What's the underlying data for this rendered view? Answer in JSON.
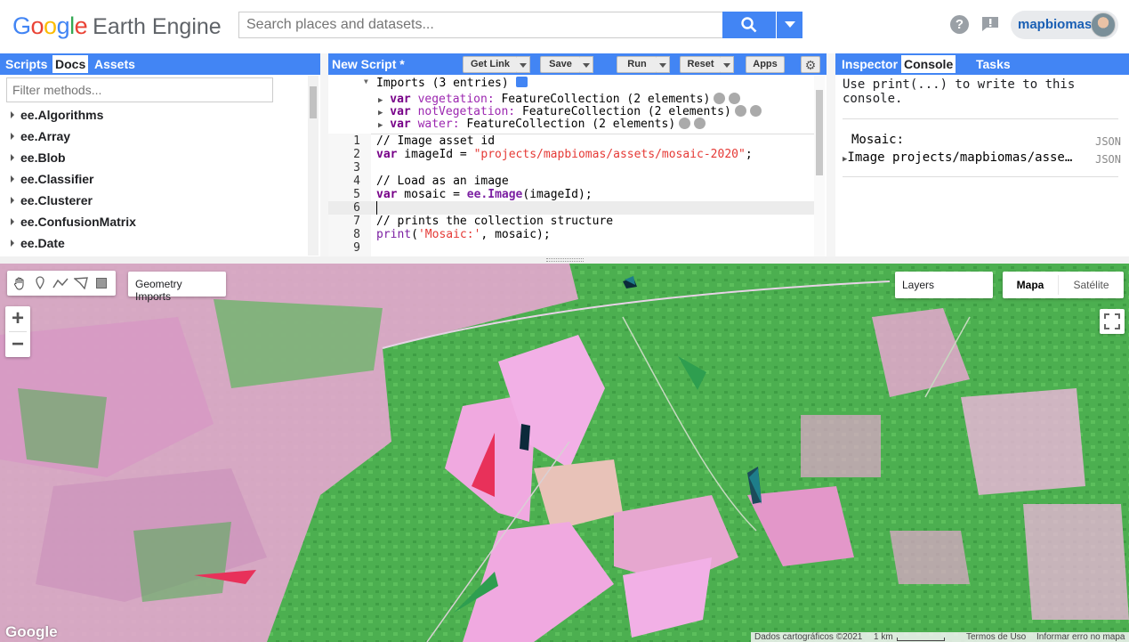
{
  "header": {
    "logo_google": "Google",
    "logo_product": "Earth Engine",
    "search_placeholder": "Search places and datasets...",
    "username": "mapbiomas"
  },
  "left_panel": {
    "tabs": [
      "Scripts",
      "Docs",
      "Assets"
    ],
    "active_tab": "Docs",
    "filter_placeholder": "Filter methods...",
    "doc_items": [
      "ee.Algorithms",
      "ee.Array",
      "ee.Blob",
      "ee.Classifier",
      "ee.Clusterer",
      "ee.ConfusionMatrix",
      "ee.Date"
    ]
  },
  "editor": {
    "title": "New Script *",
    "buttons": {
      "get_link": "Get Link",
      "save": "Save",
      "run": "Run",
      "reset": "Reset",
      "apps": "Apps"
    },
    "imports_header": "Imports (3 entries)",
    "imports": [
      {
        "kw": "var",
        "name": "vegetation:",
        "type": "FeatureCollection (2 elements)"
      },
      {
        "kw": "var",
        "name": "notVegetation:",
        "type": "FeatureCollection (2 elements)"
      },
      {
        "kw": "var",
        "name": "water:",
        "type": "FeatureCollection (2 elements)"
      }
    ],
    "line_numbers": [
      "1",
      "2",
      "3",
      "4",
      "5",
      "6",
      "7",
      "8",
      "9"
    ],
    "code": {
      "l1": "// Image asset id",
      "l2_kw": "var",
      "l2_rest": " imageId = ",
      "l2_str": "\"projects/mapbiomas/assets/mosaic-2020\"",
      "l2_end": ";",
      "l4": "// Load as an image",
      "l5_kw": "var",
      "l5_rest": " mosaic = ",
      "l5_fn": "ee.Image",
      "l5_end": "(imageId);",
      "l7": "// prints the collection structure",
      "l8_fn": "print",
      "l8_open": "(",
      "l8_str": "'Mosaic:'",
      "l8_end": ", mosaic);"
    }
  },
  "right_panel": {
    "tabs": [
      "Inspector",
      "Console",
      "Tasks"
    ],
    "active_tab": "Console",
    "help_text": "Use print(...) to write to this console.",
    "entries": [
      {
        "text": "Mosaic:",
        "badge": "JSON"
      },
      {
        "text": "Image projects/mapbiomas/asse…",
        "badge": "JSON"
      }
    ]
  },
  "map": {
    "geometry_imports": "Geometry Imports",
    "layers": "Layers",
    "map_types": [
      "Mapa",
      "Satélite"
    ],
    "active_map_type": "Mapa",
    "zoom_in": "+",
    "zoom_out": "−",
    "watermark": "Google",
    "attribution": {
      "data": "Dados cartográficos ©2021",
      "scale": "1 km",
      "terms": "Termos de Uso",
      "report": "Informar erro no mapa"
    }
  },
  "colors": {
    "accent": "#4285f4",
    "vegetation_marker": "#2e9e4f",
    "not_vegetation_marker": "#e8315a",
    "water_marker": "#1e7d8a"
  }
}
